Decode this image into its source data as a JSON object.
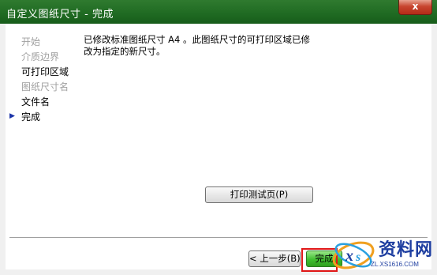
{
  "window": {
    "title": "自定义图纸尺寸 - 完成",
    "close_glyph": "x"
  },
  "steps": [
    {
      "label": "开始",
      "state": "disabled"
    },
    {
      "label": "介质边界",
      "state": "disabled"
    },
    {
      "label": "可打印区域",
      "state": "normal"
    },
    {
      "label": "图纸尺寸名",
      "state": "disabled"
    },
    {
      "label": "文件名",
      "state": "normal"
    },
    {
      "label": "完成",
      "state": "current"
    }
  ],
  "current_marker": "▶",
  "message": {
    "line1": "已修改标准图纸尺寸  A4 。此图纸尺寸的可打印区域已修",
    "line2": "改为指定的新尺寸。"
  },
  "buttons": {
    "print_test": "打印测试页(P)",
    "back": "< 上一步(B)",
    "finish": "完成"
  },
  "watermark": {
    "text": "资料网",
    "url": "ZL.XS1616.COM"
  },
  "colors": {
    "titlebar": "#1f6a22",
    "highlight": "#e01818",
    "finish_button": "#3fbf2f"
  }
}
